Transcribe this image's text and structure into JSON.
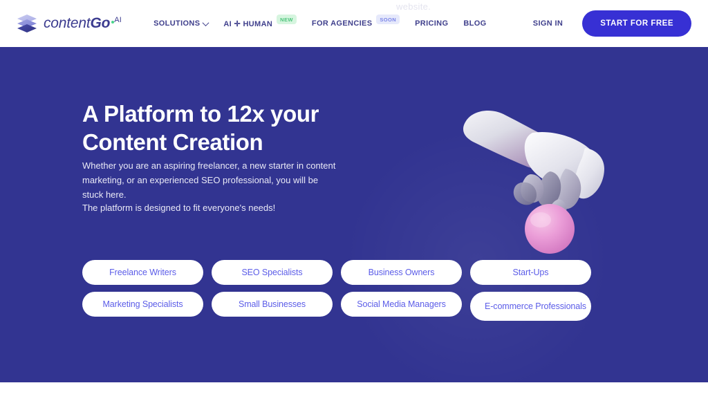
{
  "header": {
    "logo": {
      "text_light": "content",
      "text_bold": "Go",
      "superscript": "AI",
      "icon": "stacked-layers-logo"
    },
    "watermark": "website.",
    "nav": [
      {
        "label": "SOLUTIONS",
        "has_chevron": true,
        "badge": null
      },
      {
        "label": "AI ✛ HUMAN",
        "has_chevron": false,
        "badge": "NEW"
      },
      {
        "label": "FOR AGENCIES",
        "has_chevron": false,
        "badge": "SOON"
      },
      {
        "label": "PRICING",
        "has_chevron": false,
        "badge": null
      },
      {
        "label": "BLOG",
        "has_chevron": false,
        "badge": null
      }
    ],
    "sign_in": "SIGN IN",
    "cta": "START FOR FREE"
  },
  "hero": {
    "title": "A Platform to 12x your Content Creation",
    "paragraph1": "Whether you are an aspiring freelancer, a new starter in content marketing, or an experienced SEO professional, you will be stuck here.",
    "paragraph2": "The platform is designed to fit everyone's needs!",
    "illustration": "3d-hand-balancing-pink-sphere",
    "audience_rows": [
      [
        "Freelance Writers",
        "SEO Specialists",
        "Business Owners",
        "Start-Ups"
      ],
      [
        "Marketing Specialists",
        "Small Businesses",
        "Social Media Managers",
        "E-commerce Professionals"
      ]
    ]
  },
  "colors": {
    "hero_background": "#323491",
    "cta_background": "#3730d4",
    "pill_text": "#5b5ce8",
    "nav_text": "#3f3f8c",
    "badge_new_bg": "#d6f5df",
    "badge_new_text": "#4ec47c",
    "badge_soon_bg": "#e6e9fb",
    "badge_soon_text": "#7b85e8",
    "sphere": "#e88ad0",
    "logo_accent_dot": "#4ad48a"
  }
}
